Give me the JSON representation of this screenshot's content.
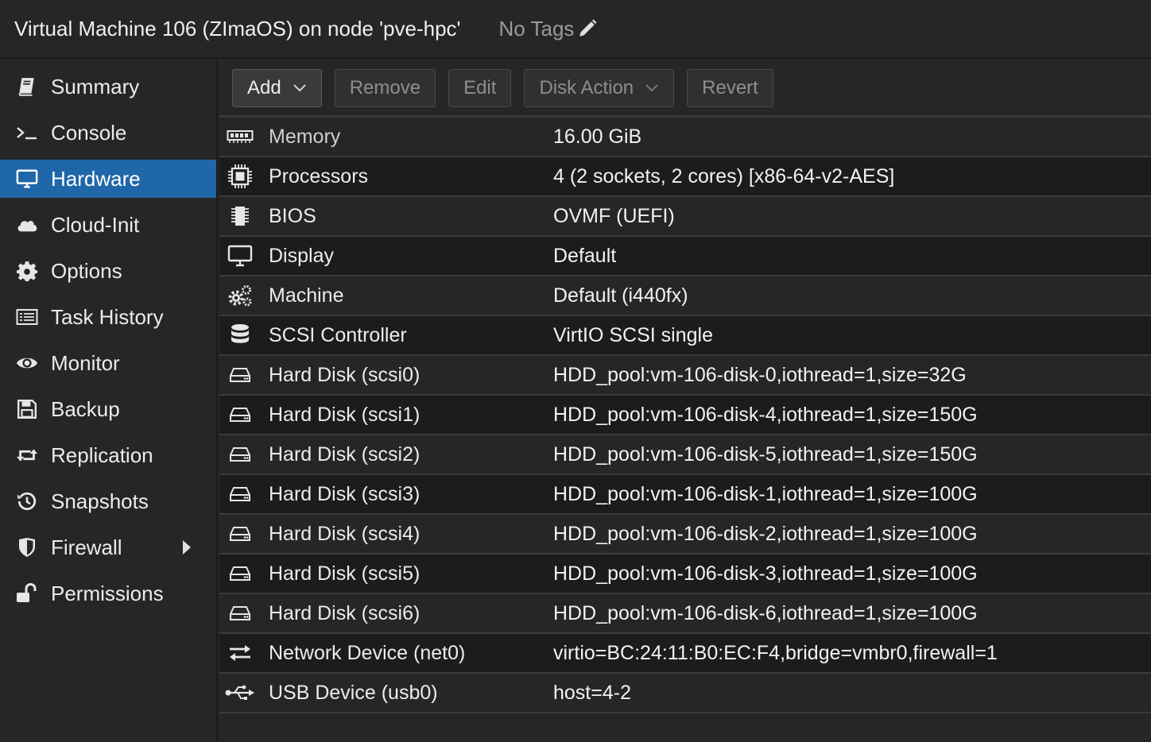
{
  "header": {
    "title": "Virtual Machine 106 (ZImaOS) on node 'pve-hpc'",
    "tags": "No Tags"
  },
  "sidebar": {
    "items": [
      {
        "label": "Summary",
        "icon": "book-icon"
      },
      {
        "label": "Console",
        "icon": "terminal-icon"
      },
      {
        "label": "Hardware",
        "icon": "monitor-icon",
        "active": true
      },
      {
        "label": "Cloud-Init",
        "icon": "cloud-icon"
      },
      {
        "label": "Options",
        "icon": "gear-icon"
      },
      {
        "label": "Task History",
        "icon": "list-icon"
      },
      {
        "label": "Monitor",
        "icon": "eye-icon"
      },
      {
        "label": "Backup",
        "icon": "floppy-icon"
      },
      {
        "label": "Replication",
        "icon": "retweet-icon"
      },
      {
        "label": "Snapshots",
        "icon": "history-icon"
      },
      {
        "label": "Firewall",
        "icon": "shield-icon"
      },
      {
        "label": "Permissions",
        "icon": "unlock-icon"
      }
    ]
  },
  "toolbar": {
    "add": "Add",
    "remove": "Remove",
    "edit": "Edit",
    "disk_action": "Disk Action",
    "revert": "Revert"
  },
  "hardware": [
    {
      "key": "Memory",
      "value": "16.00 GiB",
      "icon": "memory-icon"
    },
    {
      "key": "Processors",
      "value": "4 (2 sockets, 2 cores) [x86-64-v2-AES]",
      "icon": "cpu-icon"
    },
    {
      "key": "BIOS",
      "value": "OVMF (UEFI)",
      "icon": "chip-icon"
    },
    {
      "key": "Display",
      "value": "Default",
      "icon": "desktop-icon"
    },
    {
      "key": "Machine",
      "value": "Default (i440fx)",
      "icon": "cogs-icon"
    },
    {
      "key": "SCSI Controller",
      "value": "VirtIO SCSI single",
      "icon": "database-icon"
    },
    {
      "key": "Hard Disk (scsi0)",
      "value": "HDD_pool:vm-106-disk-0,iothread=1,size=32G",
      "icon": "hdd-icon"
    },
    {
      "key": "Hard Disk (scsi1)",
      "value": "HDD_pool:vm-106-disk-4,iothread=1,size=150G",
      "icon": "hdd-icon"
    },
    {
      "key": "Hard Disk (scsi2)",
      "value": "HDD_pool:vm-106-disk-5,iothread=1,size=150G",
      "icon": "hdd-icon"
    },
    {
      "key": "Hard Disk (scsi3)",
      "value": "HDD_pool:vm-106-disk-1,iothread=1,size=100G",
      "icon": "hdd-icon"
    },
    {
      "key": "Hard Disk (scsi4)",
      "value": "HDD_pool:vm-106-disk-2,iothread=1,size=100G",
      "icon": "hdd-icon"
    },
    {
      "key": "Hard Disk (scsi5)",
      "value": "HDD_pool:vm-106-disk-3,iothread=1,size=100G",
      "icon": "hdd-icon"
    },
    {
      "key": "Hard Disk (scsi6)",
      "value": "HDD_pool:vm-106-disk-6,iothread=1,size=100G",
      "icon": "hdd-icon"
    },
    {
      "key": "Network Device (net0)",
      "value": "virtio=BC:24:11:B0:EC:F4,bridge=vmbr0,firewall=1",
      "icon": "exchange-icon"
    },
    {
      "key": "USB Device (usb0)",
      "value": "host=4-2",
      "icon": "usb-icon"
    }
  ]
}
